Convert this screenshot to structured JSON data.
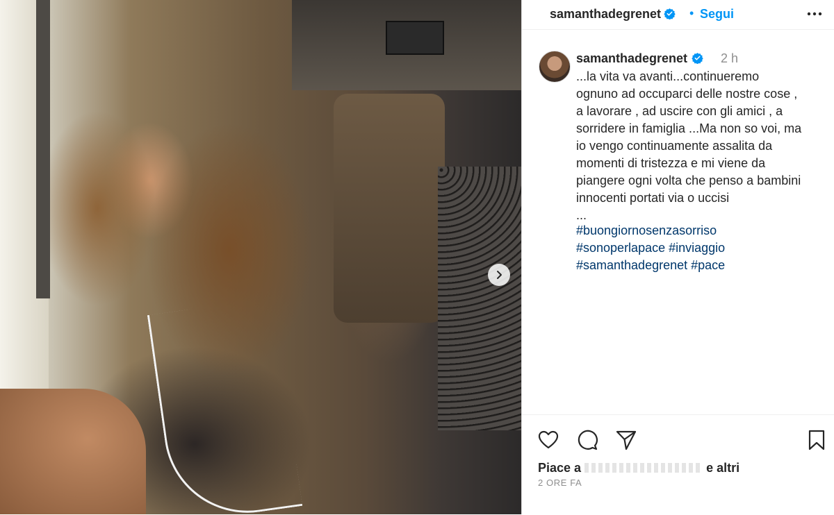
{
  "post": {
    "username": "samanthadegrenet",
    "follow_label": "Segui",
    "separator": "•",
    "time_ago": "2 h",
    "caption": "...la vita va avanti...continueremo\nognuno ad occuparci delle nostre cose ,\na lavorare , ad uscire con gli amici , a\nsorridere in famiglia ...Ma non so voi, ma\nio vengo continuamente assalita da\nmomenti di tristezza e mi viene da\npiangere ogni volta che penso a bambini\ninnocenti portati via o uccisi\n...",
    "hashtags": [
      "#buongiornosenzasorriso",
      "#sonoperlapace",
      "#inviaggio",
      "#samanthadegrenet",
      "#pace"
    ],
    "likes_prefix": "Piace a",
    "likes_suffix": "e altri",
    "timestamp": "2 ORE FA"
  },
  "icons": {
    "verified": "verified-badge-icon",
    "more": "more-options-icon",
    "next": "chevron-right-icon",
    "like": "heart-icon",
    "comment": "comment-icon",
    "share": "send-icon",
    "save": "bookmark-icon"
  },
  "colors": {
    "accent": "#0095f6",
    "hashtag": "#00376b",
    "text": "#262626",
    "muted": "#8e8e8e"
  }
}
